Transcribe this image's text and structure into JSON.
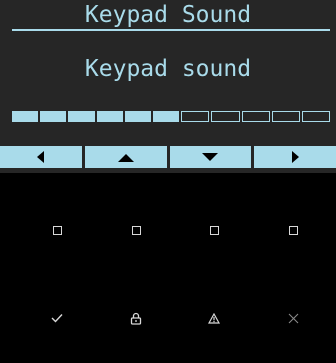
{
  "screen": {
    "title": "Keypad Sound",
    "message": "Keypad sound",
    "volume_level": {
      "value": 6,
      "max": 11
    }
  },
  "softkeys": [
    {
      "icon": "left-arrow-icon"
    },
    {
      "icon": "up-arrow-icon"
    },
    {
      "icon": "down-arrow-icon"
    },
    {
      "icon": "right-arrow-icon"
    }
  ],
  "keypad": {
    "function_keys": [
      {
        "icon": "square-icon"
      },
      {
        "icon": "square-icon"
      },
      {
        "icon": "square-icon"
      },
      {
        "icon": "square-icon"
      }
    ],
    "action_keys": [
      {
        "icon": "check-icon"
      },
      {
        "icon": "lock-icon"
      },
      {
        "icon": "warning-icon"
      },
      {
        "icon": "close-icon"
      }
    ]
  },
  "colors": {
    "lcd_background": "#262626",
    "lcd_text": "#a9dbea",
    "key_glyph": "#d8d8d8"
  }
}
